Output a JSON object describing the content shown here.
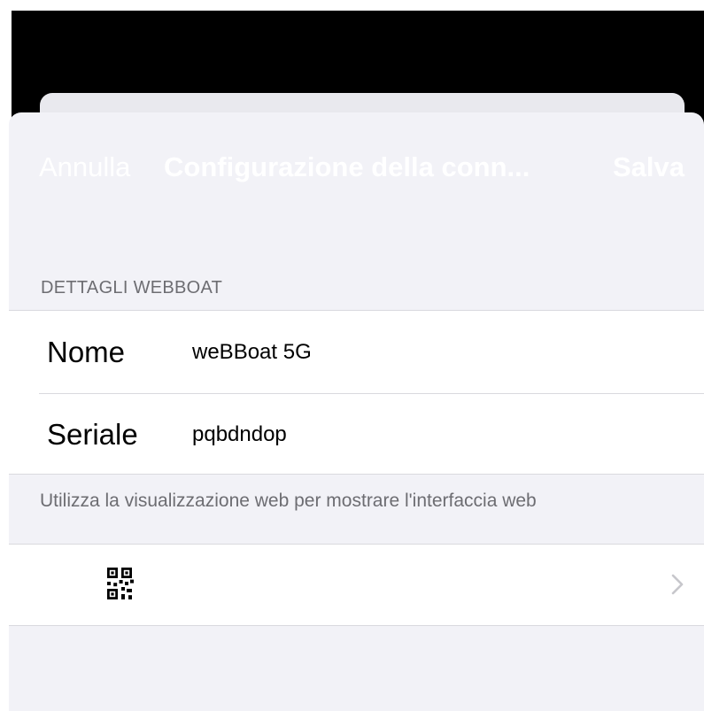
{
  "navbar": {
    "cancel_label": "Annulla",
    "title": "Configurazione della conn...",
    "save_label": "Salva"
  },
  "details_section": {
    "header": "DETTAGLI WEBBOAT",
    "rows": [
      {
        "label": "Nome",
        "value": "weBBoat 5G"
      },
      {
        "label": "Seriale",
        "value": "pqbdndop"
      }
    ]
  },
  "web_section": {
    "footer": "Utilizza la visualizzazione web per mostrare l'interfaccia web",
    "row_icon": "qr-code-icon",
    "row_accessory": "chevron-right-icon"
  },
  "colors": {
    "background": "#f2f2f7",
    "cell": "#ffffff",
    "secondary_text": "#6d6d72",
    "separator": "#d9d9de",
    "chevron": "#c7c7cc"
  }
}
